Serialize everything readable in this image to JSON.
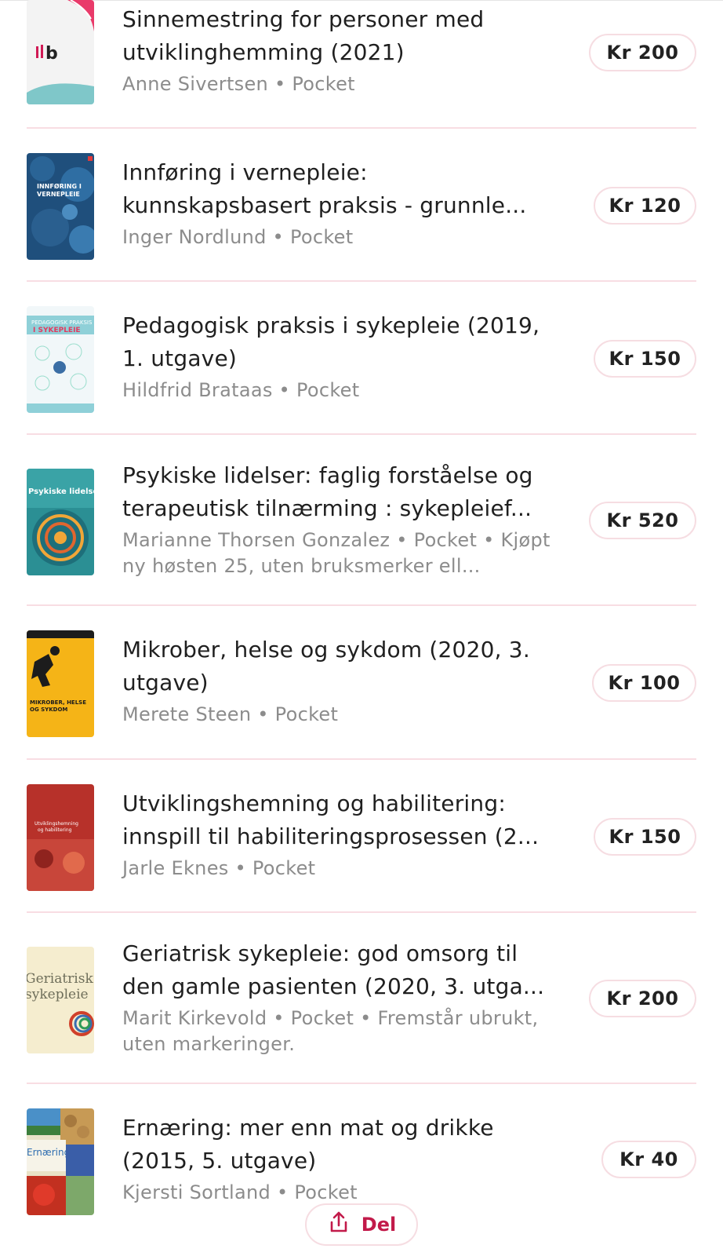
{
  "books": [
    {
      "title": "Sinnemestring for personer med utviklinghemming (2021)",
      "meta": "Anne Sivertsen • Pocket",
      "price": "Kr 200",
      "cover": {
        "label": "ılb",
        "bg": "#f3f3f3",
        "accent": "#d01a55"
      }
    },
    {
      "title": "Innføring i vernepleie: kunnskapsbasert praksis - grunnle...",
      "meta": "Inger Nordlund • Pocket",
      "price": "Kr 120",
      "cover": {
        "label": "INNFØRING I VERNEPLEIE",
        "bg": "#1f4f7c",
        "accent": "#3d78a8"
      }
    },
    {
      "title": "Pedagogisk praksis i sykepleie (2019, 1. utgave)",
      "meta": "Hildfrid Brataas • Pocket",
      "price": "Kr 150",
      "cover": {
        "label": "PEDAGOGISK PRAKSIS I SYKEPLEIE",
        "bg": "#f1f7f9",
        "accent": "#e23a5f"
      }
    },
    {
      "title": "Psykiske lidelser: faglig forståelse og terapeutisk tilnærming : sykepleief...",
      "meta": "Marianne Thorsen Gonzalez • Pocket • Kjøpt ny høsten 25, uten bruksmerker ell...",
      "price": "Kr 520",
      "cover": {
        "label": "Psykiske lidelser",
        "bg": "#2b8f94",
        "accent": "#f1a638"
      }
    },
    {
      "title": "Mikrober, helse og sykdom (2020, 3. utgave)",
      "meta": "Merete Steen • Pocket",
      "price": "Kr 100",
      "cover": {
        "label": "MIKROBER, HELSE OG SYKDOM",
        "bg": "#f5b417",
        "accent": "#1c1c1c"
      }
    },
    {
      "title": "Utviklingshemning og habilitering: innspill til habiliteringsprosessen (2...",
      "meta": "Jarle Eknes • Pocket",
      "price": "Kr 150",
      "cover": {
        "label": "Utviklingshemning og habilitering",
        "bg": "#b7312a",
        "accent": "#e16a4c"
      }
    },
    {
      "title": "Geriatrisk sykepleie: god omsorg til den gamle pasienten (2020, 3. utga...",
      "meta": "Marit Kirkevold • Pocket • Fremstår ubrukt, uten markeringer.",
      "price": "Kr 200",
      "cover": {
        "label": "Geriatrisk sykepleie",
        "bg": "#f5edcf",
        "accent": "#7a7a50"
      }
    },
    {
      "title": "Ernæring: mer enn mat og drikke (2015, 5. utgave)",
      "meta": "Kjersti Sortland • Pocket",
      "price": "Kr 40",
      "cover": {
        "label": "Ernæring",
        "bg": "#e9e2c6",
        "accent": "#2e6db0"
      }
    }
  ],
  "share": {
    "label": "Del"
  },
  "colors": {
    "brand": "#c21a4a",
    "divider": "#f8dde3",
    "pill_border": "#f6dde2",
    "meta_text": "#8c8c8c"
  }
}
